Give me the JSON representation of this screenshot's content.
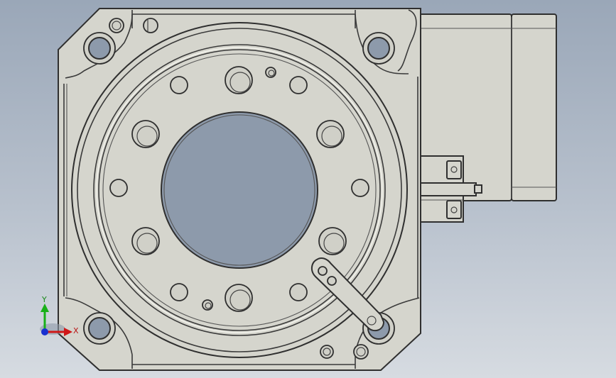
{
  "viewport": {
    "background_top": "#9aa7b8",
    "background_bottom": "#d6dbe1"
  },
  "model": {
    "part_color": "#d5d5cd",
    "edge_color": "#2f2f2f",
    "bore_color": "#8d9aab"
  },
  "triad": {
    "x_label": "X",
    "y_label": "Y",
    "x_color": "#d01818",
    "y_color": "#18b018",
    "z_color": "#1830d0"
  }
}
